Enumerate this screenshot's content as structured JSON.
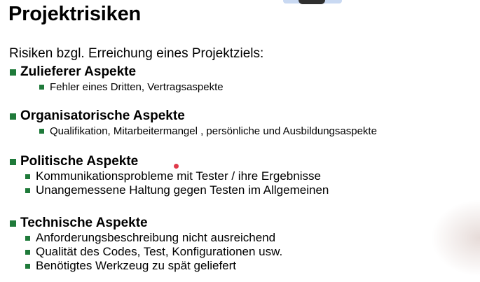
{
  "title": "Projektrisiken",
  "intro": "Risiken bzgl. Erreichung eines Projektziels:",
  "sections": [
    {
      "title": "Zulieferer Aspekte",
      "items": [
        "Fehler eines Dritten, Vertragsaspekte"
      ]
    },
    {
      "title": "Organisatorische Aspekte",
      "items": [
        "Qualifikation, Mitarbeitermangel , persönliche und Ausbildungsaspekte"
      ]
    },
    {
      "title": "Politische Aspekte",
      "items": [
        "Kommunikationsprobleme mit Tester / ihre Ergebnisse",
        "Unangemessene Haltung gegen Testen im Allgemeinen"
      ]
    },
    {
      "title": "Technische Aspekte",
      "items": [
        "Anforderungsbeschreibung nicht ausreichend",
        "Qualität des Codes, Test, Konfigurationen usw.",
        "Benötigtes Werkzeug zu spät geliefert"
      ]
    }
  ],
  "colors": {
    "bullet": "#1f7a3a",
    "pointer": "#e03a4a",
    "topbar": "#c9d9f2"
  }
}
